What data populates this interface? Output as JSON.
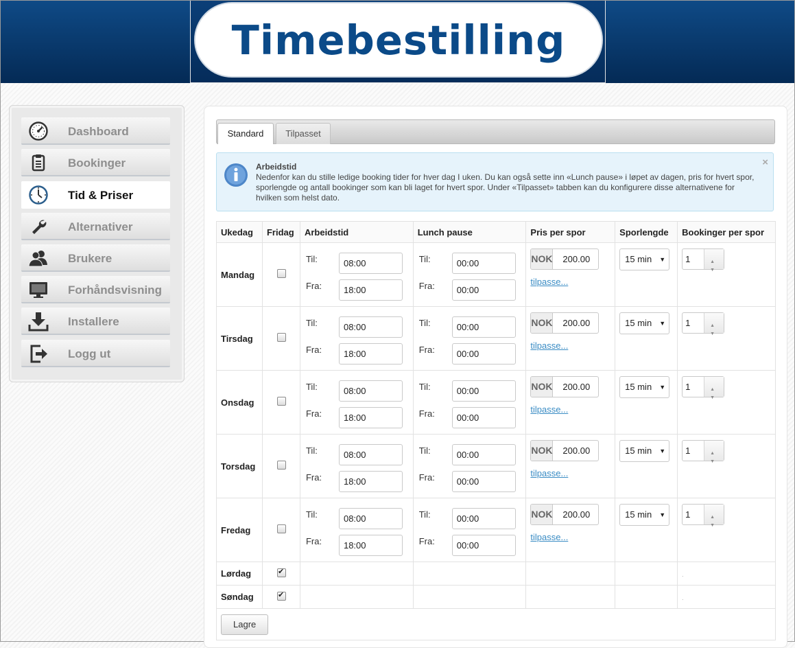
{
  "header": {
    "title": "Timebestilling"
  },
  "sidebar": {
    "items": [
      {
        "label": "Dashboard",
        "icon": "dashboard-gauge-icon",
        "active": false
      },
      {
        "label": "Bookinger",
        "icon": "clipboard-icon",
        "active": false
      },
      {
        "label": "Tid & Priser",
        "icon": "clock-icon",
        "active": true
      },
      {
        "label": "Alternativer",
        "icon": "wrench-icon",
        "active": false
      },
      {
        "label": "Brukere",
        "icon": "users-icon",
        "active": false
      },
      {
        "label": "Forhåndsvisning",
        "icon": "monitor-icon",
        "active": false
      },
      {
        "label": "Installere",
        "icon": "download-icon",
        "active": false
      },
      {
        "label": "Logg ut",
        "icon": "logout-icon",
        "active": false
      }
    ]
  },
  "tabs": [
    {
      "label": "Standard",
      "active": true
    },
    {
      "label": "Tilpasset",
      "active": false
    }
  ],
  "alert": {
    "title": "Arbeidstid",
    "text": "Nedenfor kan du stille ledige booking tider for hver dag I uken. Du kan også sette inn «Lunch pause» i løpet av dagen, pris for hvert spor, sporlengde og antall bookinger som kan bli laget for hvert spor. Under «Tilpasset» tabben kan du konfigurere disse alternativene for hvilken som helst dato.",
    "close": "×"
  },
  "table": {
    "headers": {
      "day": "Ukedag",
      "dayoff": "Fridag",
      "worktime": "Arbeidstid",
      "lunch": "Lunch pause",
      "price": "Pris per spor",
      "length": "Sporlengde",
      "bookings": "Bookinger per spor"
    },
    "labels": {
      "til": "Til:",
      "fra": "Fra:",
      "currency": "NOK",
      "customize": "tilpasse..."
    },
    "rows": [
      {
        "day": "Mandag",
        "dayoff": false,
        "work_til": "08:00",
        "work_fra": "18:00",
        "lunch_til": "00:00",
        "lunch_fra": "00:00",
        "price": "200.00",
        "length": "15 min",
        "bookings": "1"
      },
      {
        "day": "Tirsdag",
        "dayoff": false,
        "work_til": "08:00",
        "work_fra": "18:00",
        "lunch_til": "00:00",
        "lunch_fra": "00:00",
        "price": "200.00",
        "length": "15 min",
        "bookings": "1"
      },
      {
        "day": "Onsdag",
        "dayoff": false,
        "work_til": "08:00",
        "work_fra": "18:00",
        "lunch_til": "00:00",
        "lunch_fra": "00:00",
        "price": "200.00",
        "length": "15 min",
        "bookings": "1"
      },
      {
        "day": "Torsdag",
        "dayoff": false,
        "work_til": "08:00",
        "work_fra": "18:00",
        "lunch_til": "00:00",
        "lunch_fra": "00:00",
        "price": "200.00",
        "length": "15 min",
        "bookings": "1"
      },
      {
        "day": "Fredag",
        "dayoff": false,
        "work_til": "08:00",
        "work_fra": "18:00",
        "lunch_til": "00:00",
        "lunch_fra": "00:00",
        "price": "200.00",
        "length": "15 min",
        "bookings": "1"
      }
    ],
    "weekend": [
      {
        "day": "Lørdag",
        "dayoff": true
      },
      {
        "day": "Søndag",
        "dayoff": true
      }
    ],
    "save_label": "Lagre"
  }
}
